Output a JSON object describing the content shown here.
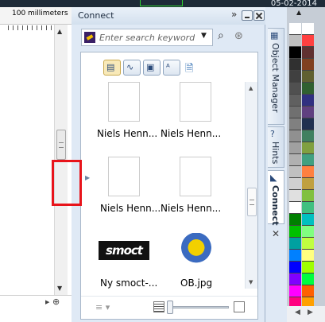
{
  "top": {
    "date": "05-02-2014"
  },
  "ruler": {
    "unit_label": "100 millimeters"
  },
  "docker": {
    "title": "Connect",
    "search_placeholder": "Enter search keywords, a",
    "thumbnails": [
      {
        "caption": "Niels Henn...",
        "icon": "image-thumbnail-sketch"
      },
      {
        "caption": "Niels Henn...",
        "icon": "image-thumbnail-color-sketch"
      },
      {
        "caption": "Niels Henn...",
        "icon": "image-thumbnail-bw"
      },
      {
        "caption": "Niels Henn...",
        "icon": "image-thumbnail-photo"
      },
      {
        "caption": "Ny smoct-...",
        "icon": "smoct-logo"
      },
      {
        "caption": "OB.jpg",
        "icon": "ob-logo"
      }
    ],
    "smoct_logo_text": "smoct"
  },
  "tabs": [
    {
      "label": "Object Manager"
    },
    {
      "label": "Hints"
    },
    {
      "label": "Connect"
    }
  ],
  "palette_colors": [
    "#ffffff",
    "#c0c0c0",
    "#000000",
    "#303030",
    "#404040",
    "#505050",
    "#606060",
    "#707070",
    "#808080",
    "#909090",
    "#a0a0a0",
    "#b0b0b0",
    "#c0c0c0",
    "#d0d0d0",
    "#e0e0e0",
    "#ffffff",
    "#008000",
    "#00c000",
    "#00a0a0",
    "#0080ff",
    "#0000ff",
    "#8000ff",
    "#ff00ff",
    "#ff0080",
    "#ff0000",
    "#ff8000",
    "#ffff00",
    "#80ff00",
    "#00ff00",
    "#00ff80"
  ],
  "palette_colors_right": [
    "#ffffff",
    "#ff4040",
    "#603030",
    "#804020",
    "#606030",
    "#306030",
    "#303080",
    "#604080",
    "#203050",
    "#408060",
    "#80a040",
    "#40a080",
    "#ff8040",
    "#c0a040",
    "#80c040",
    "#40c080",
    "#00c0c0",
    "#80ff80",
    "#c0ff40",
    "#ffff80",
    "#a0ff00",
    "#00ff40",
    "#ff6000",
    "#ffa000",
    "#ffe000",
    "#00ff00",
    "#80ff00",
    "#00c040",
    "#40ff00",
    "#00a000"
  ]
}
